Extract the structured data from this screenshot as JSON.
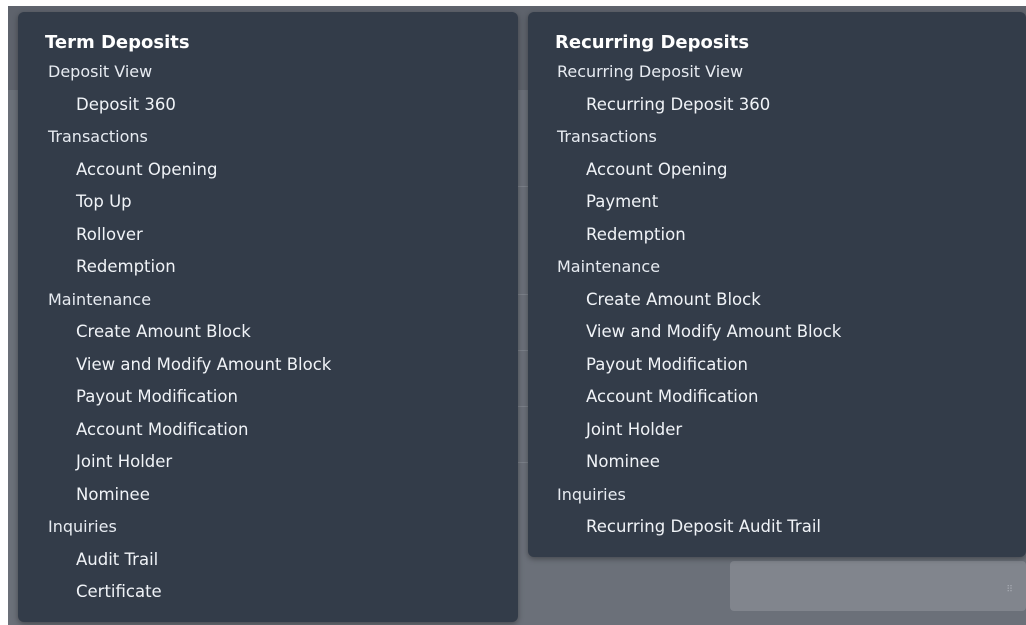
{
  "menus": {
    "term": {
      "title": "Term Deposits",
      "groups": [
        {
          "label": "Deposit View",
          "items": [
            "Deposit 360"
          ]
        },
        {
          "label": "Transactions",
          "items": [
            "Account Opening",
            "Top Up",
            "Rollover",
            "Redemption"
          ]
        },
        {
          "label": "Maintenance",
          "items": [
            "Create Amount Block",
            "View and Modify Amount Block",
            "Payout Modification",
            "Account Modification",
            "Joint Holder",
            "Nominee"
          ]
        },
        {
          "label": "Inquiries",
          "items": [
            "Audit Trail",
            "Certificate"
          ]
        }
      ]
    },
    "recurring": {
      "title": "Recurring Deposits",
      "groups": [
        {
          "label": "Recurring Deposit View",
          "items": [
            "Recurring Deposit 360"
          ]
        },
        {
          "label": "Transactions",
          "items": [
            "Account Opening",
            "Payment",
            "Redemption"
          ]
        },
        {
          "label": "Maintenance",
          "items": [
            "Create Amount Block",
            "View and Modify Amount Block",
            "Payout Modification",
            "Account Modification",
            "Joint Holder",
            "Nominee"
          ]
        },
        {
          "label": "Inquiries",
          "items": [
            "Recurring Deposit Audit Trail"
          ]
        }
      ]
    }
  },
  "colors": {
    "panel_bg": "#333c49",
    "backdrop": "#6b7079",
    "text": "#f0f3f7"
  }
}
